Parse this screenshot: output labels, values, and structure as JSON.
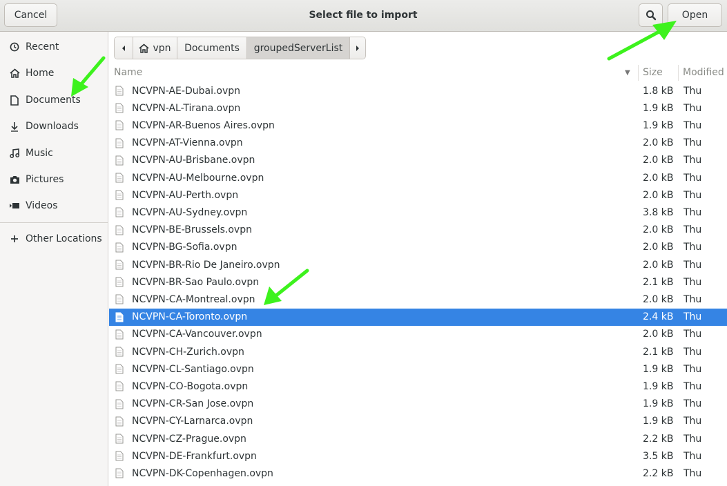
{
  "header": {
    "cancel_label": "Cancel",
    "title": "Select file to import",
    "open_label": "Open"
  },
  "sidebar": {
    "items": [
      {
        "label": "Recent",
        "icon": "clock-icon"
      },
      {
        "label": "Home",
        "icon": "home-icon"
      },
      {
        "label": "Documents",
        "icon": "document-icon"
      },
      {
        "label": "Downloads",
        "icon": "download-icon"
      },
      {
        "label": "Music",
        "icon": "music-icon"
      },
      {
        "label": "Pictures",
        "icon": "camera-icon"
      },
      {
        "label": "Videos",
        "icon": "video-icon"
      }
    ],
    "other_locations": "Other Locations"
  },
  "pathbar": {
    "segments": [
      "vpn",
      "Documents",
      "groupedServerList"
    ],
    "active": "groupedServerList"
  },
  "columns": {
    "name": "Name",
    "size": "Size",
    "modified": "Modified"
  },
  "files": [
    {
      "name": "NCVPN-AE-Dubai.ovpn",
      "size": "1.8 kB",
      "modified": "Thu"
    },
    {
      "name": "NCVPN-AL-Tirana.ovpn",
      "size": "1.9 kB",
      "modified": "Thu"
    },
    {
      "name": "NCVPN-AR-Buenos Aires.ovpn",
      "size": "1.9 kB",
      "modified": "Thu"
    },
    {
      "name": "NCVPN-AT-Vienna.ovpn",
      "size": "2.0 kB",
      "modified": "Thu"
    },
    {
      "name": "NCVPN-AU-Brisbane.ovpn",
      "size": "2.0 kB",
      "modified": "Thu"
    },
    {
      "name": "NCVPN-AU-Melbourne.ovpn",
      "size": "2.0 kB",
      "modified": "Thu"
    },
    {
      "name": "NCVPN-AU-Perth.ovpn",
      "size": "2.0 kB",
      "modified": "Thu"
    },
    {
      "name": "NCVPN-AU-Sydney.ovpn",
      "size": "3.8 kB",
      "modified": "Thu"
    },
    {
      "name": "NCVPN-BE-Brussels.ovpn",
      "size": "2.0 kB",
      "modified": "Thu"
    },
    {
      "name": "NCVPN-BG-Sofia.ovpn",
      "size": "2.0 kB",
      "modified": "Thu"
    },
    {
      "name": "NCVPN-BR-Rio De Janeiro.ovpn",
      "size": "2.0 kB",
      "modified": "Thu"
    },
    {
      "name": "NCVPN-BR-Sao Paulo.ovpn",
      "size": "2.1 kB",
      "modified": "Thu"
    },
    {
      "name": "NCVPN-CA-Montreal.ovpn",
      "size": "2.0 kB",
      "modified": "Thu"
    },
    {
      "name": "NCVPN-CA-Toronto.ovpn",
      "size": "2.4 kB",
      "modified": "Thu",
      "selected": true
    },
    {
      "name": "NCVPN-CA-Vancouver.ovpn",
      "size": "2.0 kB",
      "modified": "Thu"
    },
    {
      "name": "NCVPN-CH-Zurich.ovpn",
      "size": "2.1 kB",
      "modified": "Thu"
    },
    {
      "name": "NCVPN-CL-Santiago.ovpn",
      "size": "1.9 kB",
      "modified": "Thu"
    },
    {
      "name": "NCVPN-CO-Bogota.ovpn",
      "size": "1.9 kB",
      "modified": "Thu"
    },
    {
      "name": "NCVPN-CR-San Jose.ovpn",
      "size": "1.9 kB",
      "modified": "Thu"
    },
    {
      "name": "NCVPN-CY-Larnarca.ovpn",
      "size": "1.9 kB",
      "modified": "Thu"
    },
    {
      "name": "NCVPN-CZ-Prague.ovpn",
      "size": "2.2 kB",
      "modified": "Thu"
    },
    {
      "name": "NCVPN-DE-Frankfurt.ovpn",
      "size": "3.5 kB",
      "modified": "Thu"
    },
    {
      "name": "NCVPN-DK-Copenhagen.ovpn",
      "size": "2.2 kB",
      "modified": "Thu"
    }
  ],
  "colors": {
    "selection": "#3584e4",
    "annotation_arrow": "#3df21d"
  }
}
